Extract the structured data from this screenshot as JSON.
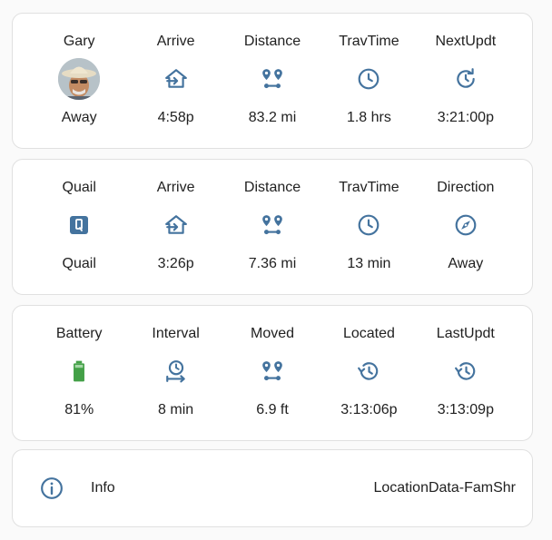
{
  "colors": {
    "icon": "#44739e",
    "battery": "#43a047"
  },
  "glance1": [
    {
      "name": "Gary",
      "icon": "avatar",
      "state": "Away"
    },
    {
      "name": "Arrive",
      "icon": "home-import-icon",
      "state": "4:58p"
    },
    {
      "name": "Distance",
      "icon": "map-marker-distance-icon",
      "state": "83.2 mi"
    },
    {
      "name": "TravTime",
      "icon": "clock-icon",
      "state": "1.8 hrs"
    },
    {
      "name": "NextUpdt",
      "icon": "update-icon",
      "state": "3:21:00p"
    }
  ],
  "glance2": [
    {
      "name": "Quail",
      "icon": "zone-badge-icon",
      "state": "Quail"
    },
    {
      "name": "Arrive",
      "icon": "home-import-icon",
      "state": "3:26p"
    },
    {
      "name": "Distance",
      "icon": "map-marker-distance-icon",
      "state": "7.36 mi"
    },
    {
      "name": "TravTime",
      "icon": "clock-icon",
      "state": "13 min"
    },
    {
      "name": "Direction",
      "icon": "compass-icon",
      "state": "Away"
    }
  ],
  "glance3": [
    {
      "name": "Battery",
      "icon": "battery-icon",
      "state": "81%"
    },
    {
      "name": "Interval",
      "icon": "timer-interval-icon",
      "state": "8 min"
    },
    {
      "name": "Moved",
      "icon": "map-marker-distance-icon",
      "state": "6.9 ft"
    },
    {
      "name": "Located",
      "icon": "history-icon",
      "state": "3:13:06p"
    },
    {
      "name": "LastUpdt",
      "icon": "history-icon",
      "state": "3:13:09p"
    }
  ],
  "info": {
    "icon": "info-icon",
    "label": "Info",
    "value": "LocationData-FamShr"
  }
}
